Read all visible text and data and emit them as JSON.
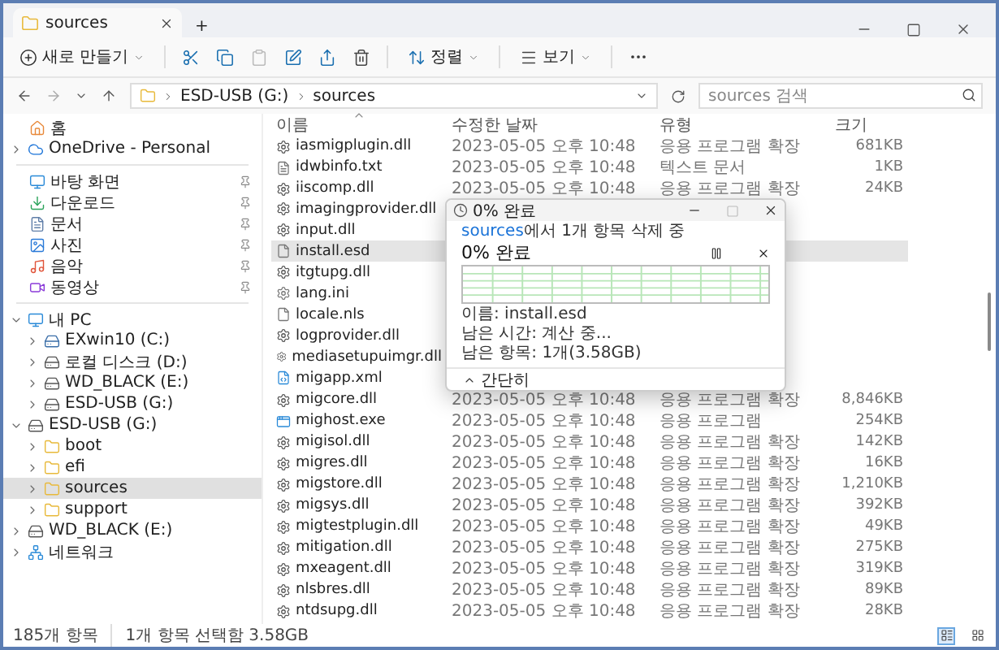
{
  "window": {
    "tab": {
      "title": "sources"
    },
    "new_tab": "+"
  },
  "toolbar": {
    "new_button": "새로 만들기",
    "sort_button": "정렬",
    "view_button": "보기"
  },
  "address": {
    "path": [
      "ESD-USB (G:)",
      "sources"
    ],
    "search": {
      "placeholder": "sources 검색"
    }
  },
  "sidebar": {
    "sections": [
      {
        "items": [
          {
            "label": "홈",
            "kind": "home"
          },
          {
            "label": "OneDrive - Personal",
            "kind": "cloud",
            "expanded": false
          }
        ]
      },
      {
        "items": [
          {
            "label": "바탕 화면",
            "kind": "desktop",
            "pinned": true
          },
          {
            "label": "다운로드",
            "kind": "download",
            "pinned": true
          },
          {
            "label": "문서",
            "kind": "documents",
            "pinned": true
          },
          {
            "label": "사진",
            "kind": "pictures",
            "pinned": true
          },
          {
            "label": "음악",
            "kind": "music",
            "pinned": true
          },
          {
            "label": "동영상",
            "kind": "videos",
            "pinned": true
          }
        ]
      },
      {
        "items": [
          {
            "label": "내 PC",
            "kind": "pc",
            "expanded": true,
            "children": [
              {
                "label": "EXwin10 (C:)",
                "kind": "system-drive",
                "expanded": false
              },
              {
                "label": "로컬 디스크 (D:)",
                "kind": "drive",
                "expanded": false
              },
              {
                "label": "WD_BLACK (E:)",
                "kind": "drive",
                "expanded": false
              },
              {
                "label": "ESD-USB (G:)",
                "kind": "drive",
                "expanded": false
              }
            ]
          },
          {
            "label": "ESD-USB (G:)",
            "kind": "drive",
            "expanded": true,
            "children": [
              {
                "label": "boot",
                "kind": "folder",
                "expanded": false,
                "selected": false
              },
              {
                "label": "efi",
                "kind": "folder",
                "expanded": false,
                "selected": false
              },
              {
                "label": "sources",
                "kind": "folder",
                "expanded": false,
                "selected": true
              },
              {
                "label": "support",
                "kind": "folder",
                "expanded": false,
                "selected": false
              }
            ]
          },
          {
            "label": "WD_BLACK (E:)",
            "kind": "drive",
            "expanded": false
          },
          {
            "label": "네트워크",
            "kind": "network",
            "expanded": false
          }
        ]
      }
    ]
  },
  "table": {
    "columns": [
      {
        "label": "이름",
        "sorted": true
      },
      {
        "label": "수정한 날짜",
        "sorted": false
      },
      {
        "label": "유형",
        "sorted": false
      },
      {
        "label": "크기",
        "sorted": false
      }
    ],
    "rows": [
      {
        "name": "iasmigplugin.dll",
        "kind": "dll",
        "date": "2023-05-05 오후 10:48",
        "type": "응용 프로그램 확장",
        "size": "681KB",
        "selected": false
      },
      {
        "name": "idwbinfo.txt",
        "kind": "text",
        "date": "2023-05-05 오후 10:48",
        "type": "텍스트 문서",
        "size": "1KB",
        "selected": false
      },
      {
        "name": "iiscomp.dll",
        "kind": "dll",
        "date": "2023-05-05 오후 10:48",
        "type": "응용 프로그램 확장",
        "size": "24KB",
        "selected": false
      },
      {
        "name": "imagingprovider.dll",
        "kind": "dll",
        "selected": false
      },
      {
        "name": "input.dll",
        "kind": "dll",
        "selected": false
      },
      {
        "name": "install.esd",
        "kind": "file",
        "selected": true
      },
      {
        "name": "itgtupg.dll",
        "kind": "dll",
        "selected": false
      },
      {
        "name": "lang.ini",
        "kind": "ini",
        "selected": false
      },
      {
        "name": "locale.nls",
        "kind": "file",
        "selected": false
      },
      {
        "name": "logprovider.dll",
        "kind": "dll",
        "selected": false
      },
      {
        "name": "mediasetupuimgr.dll",
        "kind": "dll",
        "selected": false
      },
      {
        "name": "migapp.xml",
        "kind": "xml",
        "selected": false
      },
      {
        "name": "migcore.dll",
        "kind": "dll",
        "date": "2023-05-05 오후 10:48",
        "type": "응용 프로그램 확장",
        "size": "8,846KB",
        "selected": false
      },
      {
        "name": "mighost.exe",
        "kind": "exe",
        "date": "2023-05-05 오후 10:48",
        "type": "응용 프로그램",
        "size": "254KB",
        "selected": false
      },
      {
        "name": "migisol.dll",
        "kind": "dll",
        "date": "2023-05-05 오후 10:48",
        "type": "응용 프로그램 확장",
        "size": "142KB",
        "selected": false
      },
      {
        "name": "migres.dll",
        "kind": "dll",
        "date": "2023-05-05 오후 10:48",
        "type": "응용 프로그램 확장",
        "size": "16KB",
        "selected": false
      },
      {
        "name": "migstore.dll",
        "kind": "dll",
        "date": "2023-05-05 오후 10:48",
        "type": "응용 프로그램 확장",
        "size": "1,210KB",
        "selected": false
      },
      {
        "name": "migsys.dll",
        "kind": "dll",
        "date": "2023-05-05 오후 10:48",
        "type": "응용 프로그램 확장",
        "size": "392KB",
        "selected": false
      },
      {
        "name": "migtestplugin.dll",
        "kind": "dll",
        "date": "2023-05-05 오후 10:48",
        "type": "응용 프로그램 확장",
        "size": "49KB",
        "selected": false
      },
      {
        "name": "mitigation.dll",
        "kind": "dll",
        "date": "2023-05-05 오후 10:48",
        "type": "응용 프로그램 확장",
        "size": "275KB",
        "selected": false
      },
      {
        "name": "mxeagent.dll",
        "kind": "dll",
        "date": "2023-05-05 오후 10:48",
        "type": "응용 프로그램 확장",
        "size": "319KB",
        "selected": false
      },
      {
        "name": "nlsbres.dll",
        "kind": "dll",
        "date": "2023-05-05 오후 10:48",
        "type": "응용 프로그램 확장",
        "size": "89KB",
        "selected": false
      },
      {
        "name": "ntdsupg.dll",
        "kind": "dll",
        "date": "2023-05-05 오후 10:48",
        "type": "응용 프로그램 확장",
        "size": "28KB",
        "selected": false
      }
    ]
  },
  "dialog": {
    "title": "0% 완료",
    "source_link": "sources",
    "message": "에서 1개 항목 삭제 중",
    "heading": "0% 완료",
    "details": [
      "이름: install.esd",
      "남은 시간: 계산 중...",
      "남은 항목: 1개(3.58GB)"
    ],
    "collapse_button": "간단히"
  },
  "status_bar": {
    "count": "185개 항목",
    "selection": "1개 항목 선택함 3.58GB",
    "view_buttons": [
      {
        "kind": "details",
        "selected": true
      },
      {
        "kind": "tiles",
        "selected": false
      }
    ]
  }
}
